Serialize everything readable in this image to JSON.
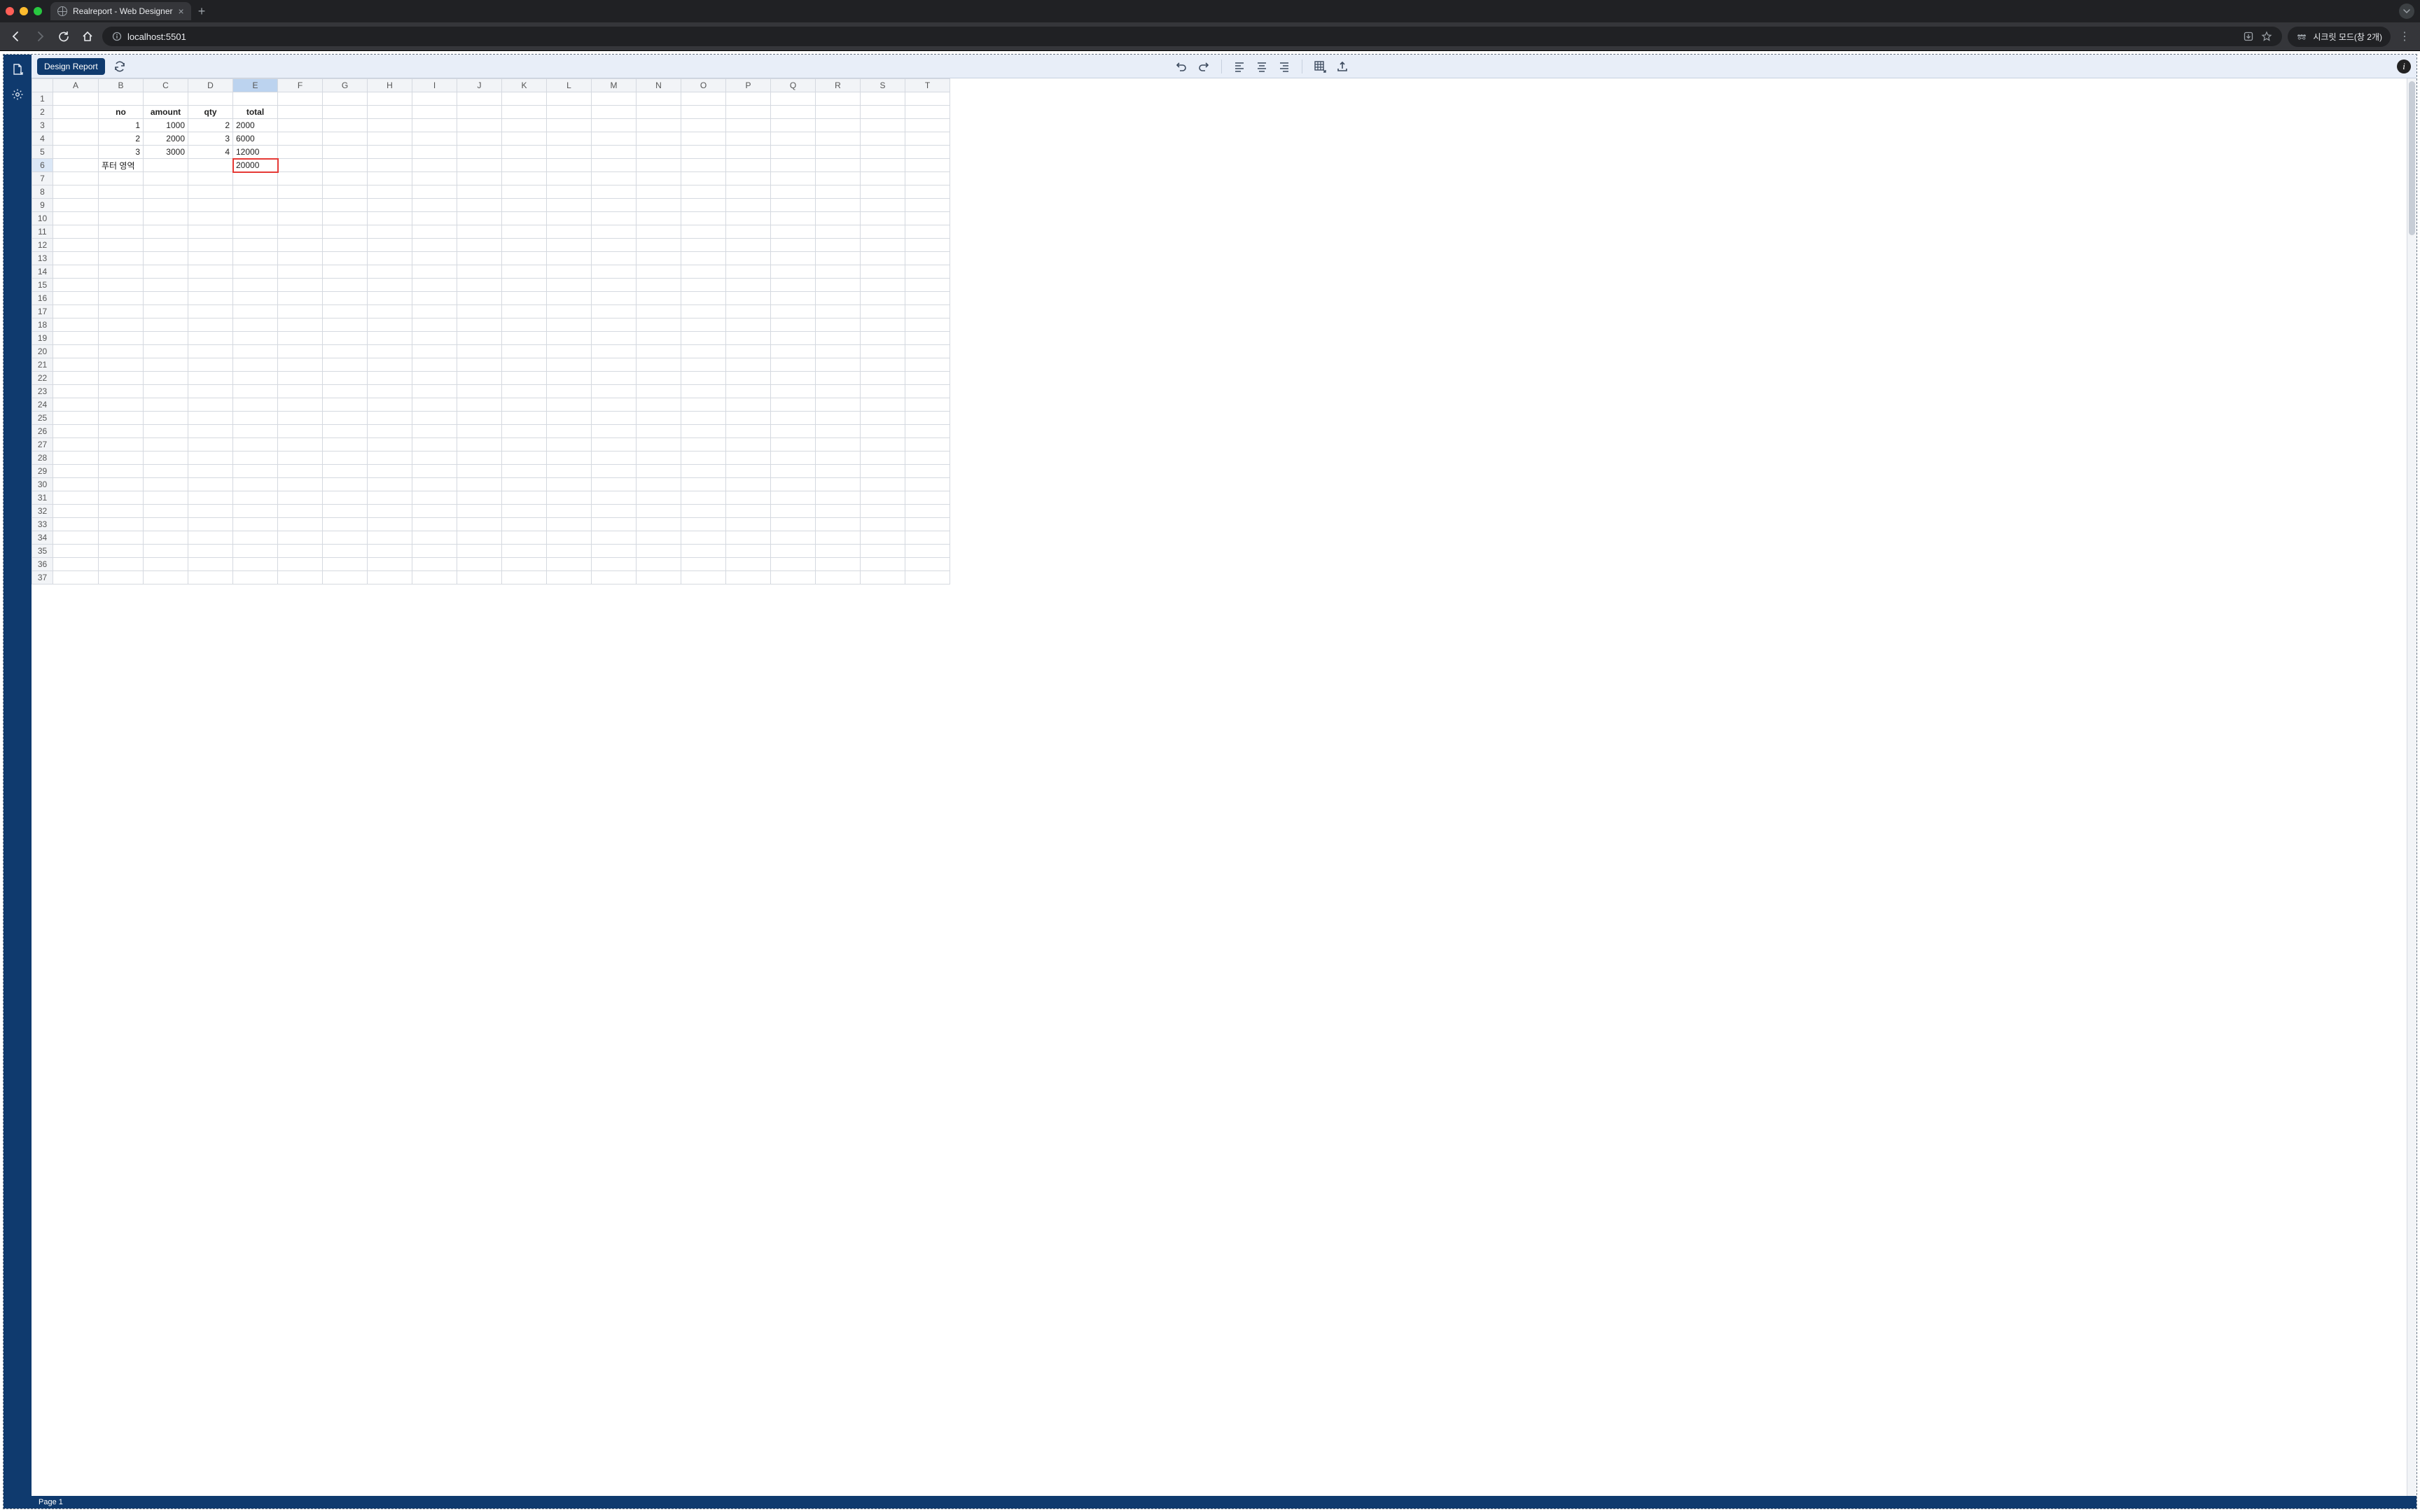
{
  "browser": {
    "tab_title": "Realreport - Web Designer",
    "url": "localhost:5501",
    "incognito_label": "시크릿 모드(창 2개)"
  },
  "toolbar": {
    "design_report": "Design Report"
  },
  "columns": [
    "A",
    "B",
    "C",
    "D",
    "E",
    "F",
    "G",
    "H",
    "I",
    "J",
    "K",
    "L",
    "M",
    "N",
    "O",
    "P",
    "Q",
    "R",
    "S",
    "T"
  ],
  "selected_column": "E",
  "selected_row": 6,
  "row_count": 37,
  "sheet": {
    "headers": {
      "B": "no",
      "C": "amount",
      "D": "qty",
      "E": "total"
    },
    "rows": [
      {
        "B": "1",
        "C": "1000",
        "D": "2",
        "E": "2000"
      },
      {
        "B": "2",
        "C": "2000",
        "D": "3",
        "E": "6000"
      },
      {
        "B": "3",
        "C": "3000",
        "D": "4",
        "E": "12000"
      }
    ],
    "footer": {
      "B": "푸터 영역",
      "E": "20000"
    }
  },
  "status": {
    "page_label": "Page 1"
  }
}
